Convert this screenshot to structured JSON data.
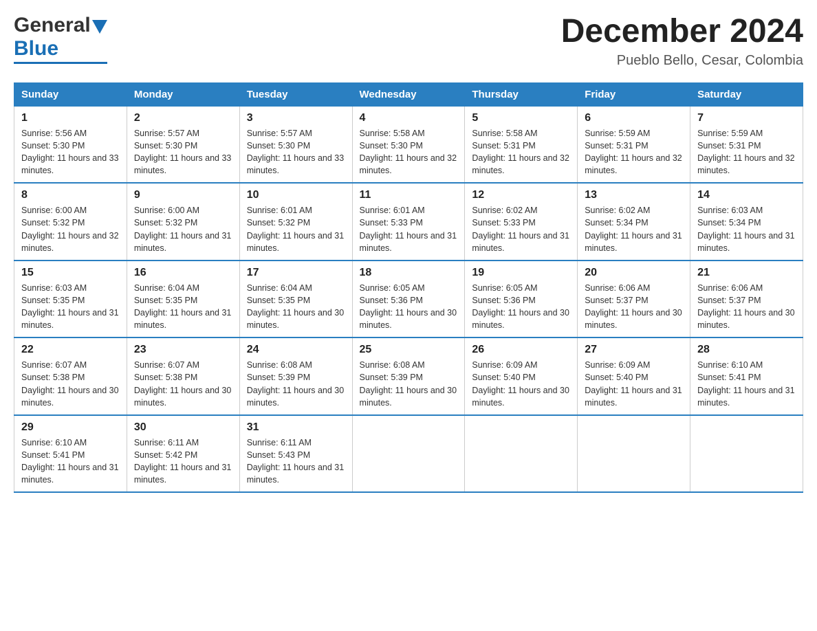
{
  "header": {
    "month_year": "December 2024",
    "location": "Pueblo Bello, Cesar, Colombia",
    "logo_general": "General",
    "logo_blue": "Blue"
  },
  "columns": [
    "Sunday",
    "Monday",
    "Tuesday",
    "Wednesday",
    "Thursday",
    "Friday",
    "Saturday"
  ],
  "weeks": [
    [
      {
        "day": "1",
        "sunrise": "Sunrise: 5:56 AM",
        "sunset": "Sunset: 5:30 PM",
        "daylight": "Daylight: 11 hours and 33 minutes."
      },
      {
        "day": "2",
        "sunrise": "Sunrise: 5:57 AM",
        "sunset": "Sunset: 5:30 PM",
        "daylight": "Daylight: 11 hours and 33 minutes."
      },
      {
        "day": "3",
        "sunrise": "Sunrise: 5:57 AM",
        "sunset": "Sunset: 5:30 PM",
        "daylight": "Daylight: 11 hours and 33 minutes."
      },
      {
        "day": "4",
        "sunrise": "Sunrise: 5:58 AM",
        "sunset": "Sunset: 5:30 PM",
        "daylight": "Daylight: 11 hours and 32 minutes."
      },
      {
        "day": "5",
        "sunrise": "Sunrise: 5:58 AM",
        "sunset": "Sunset: 5:31 PM",
        "daylight": "Daylight: 11 hours and 32 minutes."
      },
      {
        "day": "6",
        "sunrise": "Sunrise: 5:59 AM",
        "sunset": "Sunset: 5:31 PM",
        "daylight": "Daylight: 11 hours and 32 minutes."
      },
      {
        "day": "7",
        "sunrise": "Sunrise: 5:59 AM",
        "sunset": "Sunset: 5:31 PM",
        "daylight": "Daylight: 11 hours and 32 minutes."
      }
    ],
    [
      {
        "day": "8",
        "sunrise": "Sunrise: 6:00 AM",
        "sunset": "Sunset: 5:32 PM",
        "daylight": "Daylight: 11 hours and 32 minutes."
      },
      {
        "day": "9",
        "sunrise": "Sunrise: 6:00 AM",
        "sunset": "Sunset: 5:32 PM",
        "daylight": "Daylight: 11 hours and 31 minutes."
      },
      {
        "day": "10",
        "sunrise": "Sunrise: 6:01 AM",
        "sunset": "Sunset: 5:32 PM",
        "daylight": "Daylight: 11 hours and 31 minutes."
      },
      {
        "day": "11",
        "sunrise": "Sunrise: 6:01 AM",
        "sunset": "Sunset: 5:33 PM",
        "daylight": "Daylight: 11 hours and 31 minutes."
      },
      {
        "day": "12",
        "sunrise": "Sunrise: 6:02 AM",
        "sunset": "Sunset: 5:33 PM",
        "daylight": "Daylight: 11 hours and 31 minutes."
      },
      {
        "day": "13",
        "sunrise": "Sunrise: 6:02 AM",
        "sunset": "Sunset: 5:34 PM",
        "daylight": "Daylight: 11 hours and 31 minutes."
      },
      {
        "day": "14",
        "sunrise": "Sunrise: 6:03 AM",
        "sunset": "Sunset: 5:34 PM",
        "daylight": "Daylight: 11 hours and 31 minutes."
      }
    ],
    [
      {
        "day": "15",
        "sunrise": "Sunrise: 6:03 AM",
        "sunset": "Sunset: 5:35 PM",
        "daylight": "Daylight: 11 hours and 31 minutes."
      },
      {
        "day": "16",
        "sunrise": "Sunrise: 6:04 AM",
        "sunset": "Sunset: 5:35 PM",
        "daylight": "Daylight: 11 hours and 31 minutes."
      },
      {
        "day": "17",
        "sunrise": "Sunrise: 6:04 AM",
        "sunset": "Sunset: 5:35 PM",
        "daylight": "Daylight: 11 hours and 30 minutes."
      },
      {
        "day": "18",
        "sunrise": "Sunrise: 6:05 AM",
        "sunset": "Sunset: 5:36 PM",
        "daylight": "Daylight: 11 hours and 30 minutes."
      },
      {
        "day": "19",
        "sunrise": "Sunrise: 6:05 AM",
        "sunset": "Sunset: 5:36 PM",
        "daylight": "Daylight: 11 hours and 30 minutes."
      },
      {
        "day": "20",
        "sunrise": "Sunrise: 6:06 AM",
        "sunset": "Sunset: 5:37 PM",
        "daylight": "Daylight: 11 hours and 30 minutes."
      },
      {
        "day": "21",
        "sunrise": "Sunrise: 6:06 AM",
        "sunset": "Sunset: 5:37 PM",
        "daylight": "Daylight: 11 hours and 30 minutes."
      }
    ],
    [
      {
        "day": "22",
        "sunrise": "Sunrise: 6:07 AM",
        "sunset": "Sunset: 5:38 PM",
        "daylight": "Daylight: 11 hours and 30 minutes."
      },
      {
        "day": "23",
        "sunrise": "Sunrise: 6:07 AM",
        "sunset": "Sunset: 5:38 PM",
        "daylight": "Daylight: 11 hours and 30 minutes."
      },
      {
        "day": "24",
        "sunrise": "Sunrise: 6:08 AM",
        "sunset": "Sunset: 5:39 PM",
        "daylight": "Daylight: 11 hours and 30 minutes."
      },
      {
        "day": "25",
        "sunrise": "Sunrise: 6:08 AM",
        "sunset": "Sunset: 5:39 PM",
        "daylight": "Daylight: 11 hours and 30 minutes."
      },
      {
        "day": "26",
        "sunrise": "Sunrise: 6:09 AM",
        "sunset": "Sunset: 5:40 PM",
        "daylight": "Daylight: 11 hours and 30 minutes."
      },
      {
        "day": "27",
        "sunrise": "Sunrise: 6:09 AM",
        "sunset": "Sunset: 5:40 PM",
        "daylight": "Daylight: 11 hours and 31 minutes."
      },
      {
        "day": "28",
        "sunrise": "Sunrise: 6:10 AM",
        "sunset": "Sunset: 5:41 PM",
        "daylight": "Daylight: 11 hours and 31 minutes."
      }
    ],
    [
      {
        "day": "29",
        "sunrise": "Sunrise: 6:10 AM",
        "sunset": "Sunset: 5:41 PM",
        "daylight": "Daylight: 11 hours and 31 minutes."
      },
      {
        "day": "30",
        "sunrise": "Sunrise: 6:11 AM",
        "sunset": "Sunset: 5:42 PM",
        "daylight": "Daylight: 11 hours and 31 minutes."
      },
      {
        "day": "31",
        "sunrise": "Sunrise: 6:11 AM",
        "sunset": "Sunset: 5:43 PM",
        "daylight": "Daylight: 11 hours and 31 minutes."
      },
      null,
      null,
      null,
      null
    ]
  ]
}
